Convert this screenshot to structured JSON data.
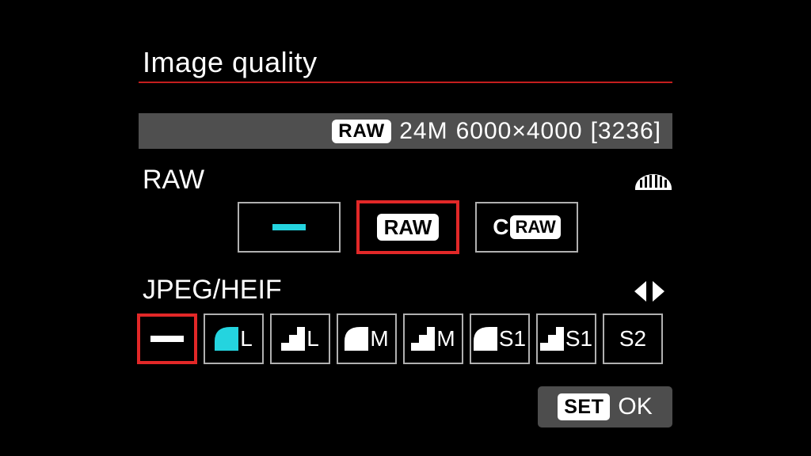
{
  "title": "Image quality",
  "info": {
    "format_badge": "RAW",
    "megapixels": "24M",
    "dimensions": "6000×4000",
    "shots_remaining": "[3236]"
  },
  "sections": {
    "raw": {
      "label": "RAW",
      "options": [
        {
          "name": "none",
          "display": "dash",
          "selected": false
        },
        {
          "name": "raw",
          "display": "RAW",
          "selected": true
        },
        {
          "name": "craw",
          "display": "CRAW",
          "selected": false
        }
      ]
    },
    "jpeg": {
      "label": "JPEG/HEIF",
      "options": [
        {
          "name": "none",
          "size": "",
          "quality": "dash",
          "selected": true
        },
        {
          "name": "large-fine",
          "size": "L",
          "quality": "fine",
          "selected": false,
          "highlight": true
        },
        {
          "name": "large-norm",
          "size": "L",
          "quality": "normal",
          "selected": false
        },
        {
          "name": "medium-fine",
          "size": "M",
          "quality": "fine",
          "selected": false
        },
        {
          "name": "medium-norm",
          "size": "M",
          "quality": "normal",
          "selected": false
        },
        {
          "name": "s1-fine",
          "size": "S1",
          "quality": "fine",
          "selected": false
        },
        {
          "name": "s1-norm",
          "size": "S1",
          "quality": "normal",
          "selected": false
        },
        {
          "name": "s2",
          "size": "S2",
          "quality": "",
          "selected": false
        }
      ]
    }
  },
  "confirm": {
    "set_label": "SET",
    "ok_label": "OK"
  }
}
